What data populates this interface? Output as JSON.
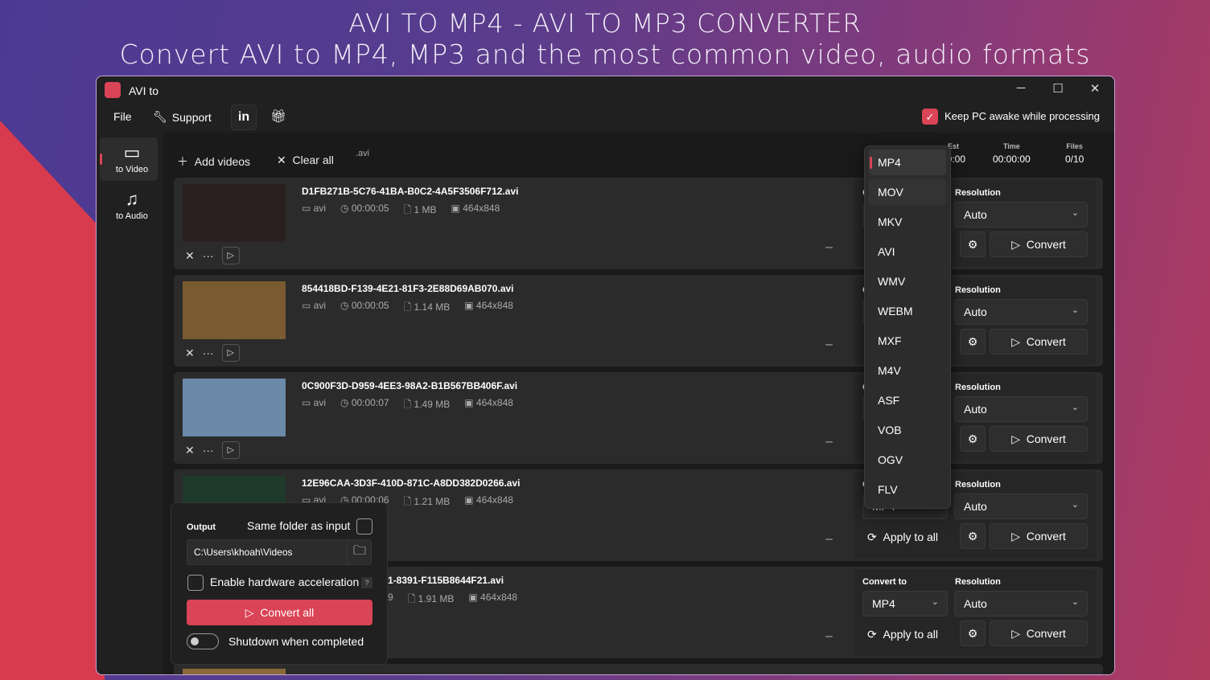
{
  "hero": {
    "line1": "AVI TO MP4 - AVI TO MP3 CONVERTER",
    "line2": "Convert AVI to MP4, MP3 and the most common video, audio formats"
  },
  "window": {
    "title": "AVI to",
    "minimize": "─",
    "maximize": "☐",
    "close": "✕"
  },
  "menu": {
    "file": "File",
    "support": "Support",
    "linkedin": "in",
    "keep_awake": "Keep PC awake while processing",
    "keep_awake_checked": true
  },
  "sidebar": [
    {
      "label": "to Video",
      "icon": "video-camera-icon",
      "active": true
    },
    {
      "label": "to Audio",
      "icon": "music-note-icon",
      "active": false
    }
  ],
  "toolbar": {
    "add": "Add videos",
    "clear": "Clear all",
    "ext": ".avi"
  },
  "stats": [
    {
      "label": "Est",
      "value": "00:00"
    },
    {
      "label": "Time",
      "value": "00:00:00"
    },
    {
      "label": "Files",
      "value": "0/10"
    }
  ],
  "rows": [
    {
      "name": "D1FB271B-5C76-41BA-B0C2-4A5F3506F712.avi",
      "fmt": "avi",
      "dur": "00:00:05",
      "size": "1 MB",
      "res": "464x848",
      "thumb": "#2a2020"
    },
    {
      "name": "854418BD-F139-4E21-81F3-2E88D69AB070.avi",
      "fmt": "avi",
      "dur": "00:00:05",
      "size": "1.14 MB",
      "res": "464x848",
      "thumb": "#7a5a30"
    },
    {
      "name": "0C900F3D-D959-4EE3-98A2-B1B567BB406F.avi",
      "fmt": "avi",
      "dur": "00:00:07",
      "size": "1.49 MB",
      "res": "464x848",
      "thumb": "#6b89a8"
    },
    {
      "name": "12E96CAA-3D3F-410D-871C-A8DD382D0266.avi",
      "fmt": "avi",
      "dur": "00:00:06",
      "size": "1.21 MB",
      "res": "464x848",
      "thumb": "#1f3a2a"
    },
    {
      "name": "1-8391-F115B8644F21.avi",
      "fmt": "",
      "dur": "9",
      "size": "1.91 MB",
      "res": "464x848",
      "thumb": ""
    }
  ],
  "row_panel": {
    "convert_to": "Convert to",
    "resolution": "Resolution",
    "resolution_value": "Auto",
    "convert": "Convert",
    "apply_all": "Apply to all",
    "format_value": "MP4"
  },
  "dropdown": {
    "options": [
      "MP4",
      "MOV",
      "MKV",
      "AVI",
      "WMV",
      "WEBM",
      "MXF",
      "M4V",
      "ASF",
      "VOB",
      "OGV",
      "FLV"
    ],
    "selected": "MP4",
    "hovered": "MOV"
  },
  "output": {
    "label": "Output",
    "same_folder": "Same folder as input",
    "same_folder_checked": false,
    "path": "C:\\Users\\khoah\\Videos",
    "hw": "Enable hardware acceleration",
    "hw_checked": false,
    "help": "?",
    "convert_all": "Convert all",
    "shutdown": "Shutdown when completed",
    "shutdown_on": false
  },
  "colors": {
    "accent": "#d94456"
  }
}
